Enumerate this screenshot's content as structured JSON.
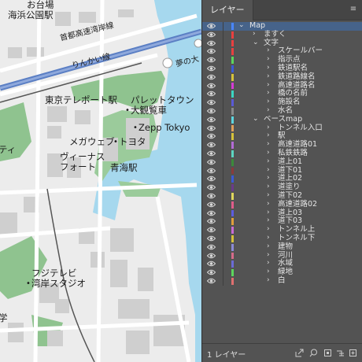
{
  "map": {
    "labels": [
      {
        "id": "odaiba",
        "text": "お台場"
      },
      {
        "id": "kaihin",
        "text": "海浜公園駅"
      },
      {
        "id": "shuto",
        "text": "首都高速湾岸線"
      },
      {
        "id": "rinkai",
        "text": "りんかい線"
      },
      {
        "id": "yume",
        "text": "夢の大"
      },
      {
        "id": "teleport",
        "text": "東京テレポート駅"
      },
      {
        "id": "palette",
        "text": "パレットタウン"
      },
      {
        "id": "kanransha",
        "text": "大観覧車"
      },
      {
        "id": "zepp",
        "text": "Zepp Tokyo"
      },
      {
        "id": "megaweb",
        "text": "メガウェブ"
      },
      {
        "id": "toyota",
        "text": "トヨタ"
      },
      {
        "id": "venus1",
        "text": "ヴィーナス"
      },
      {
        "id": "venus2",
        "text": "フォート"
      },
      {
        "id": "aomi",
        "text": "青海駅"
      },
      {
        "id": "fuji1",
        "text": "フジテレビ"
      },
      {
        "id": "fuji2",
        "text": "湾岸スタジオ"
      },
      {
        "id": "edge1",
        "text": "ティ"
      },
      {
        "id": "edge2",
        "text": "学"
      }
    ]
  },
  "panel": {
    "tab_label": "レイヤー",
    "menu_icon": "panel-menu-icon",
    "footer": {
      "count_label": "1 レイヤー",
      "icons": [
        "export-icon",
        "search-icon",
        "sublayer-icon",
        "collect-icon",
        "new-layer-icon",
        "trash-icon"
      ]
    },
    "layers": [
      {
        "name": "Map",
        "level": 0,
        "expanded": true,
        "color": "#4a86ff",
        "selected": true
      },
      {
        "name": "ますく",
        "level": 1,
        "expanded": false,
        "color": "#e94040"
      },
      {
        "name": "文字",
        "level": 1,
        "expanded": true,
        "color": "#e94040"
      },
      {
        "name": "スケールバー",
        "level": 2,
        "expanded": false,
        "color": "#e94040"
      },
      {
        "name": "指示点",
        "level": 2,
        "expanded": false,
        "color": "#5cd65c"
      },
      {
        "name": "鉄道駅名",
        "level": 2,
        "expanded": false,
        "color": "#3b5bd6"
      },
      {
        "name": "鉄道路線名",
        "level": 2,
        "expanded": false,
        "color": "#d6c23b"
      },
      {
        "name": "高速道路名",
        "level": 2,
        "expanded": false,
        "color": "#d63bd6"
      },
      {
        "name": "橋の名前",
        "level": 2,
        "expanded": false,
        "color": "#3bd6c2"
      },
      {
        "name": "施設名",
        "level": 2,
        "expanded": false,
        "color": "#5a5ad6"
      },
      {
        "name": "水名",
        "level": 2,
        "expanded": false,
        "color": "#8a8a8a"
      },
      {
        "name": "ベースmap",
        "level": 1,
        "expanded": true,
        "color": "#5cd6e0"
      },
      {
        "name": "トンネル入口",
        "level": 2,
        "expanded": false,
        "color": "#e0a05c"
      },
      {
        "name": "駅",
        "level": 2,
        "expanded": false,
        "color": "#d6c23b"
      },
      {
        "name": "高速道路01",
        "level": 2,
        "expanded": false,
        "color": "#b36bd6"
      },
      {
        "name": "私鉄鉄路",
        "level": 2,
        "expanded": false,
        "color": "#5cd6c2"
      },
      {
        "name": "道上01",
        "level": 2,
        "expanded": false,
        "color": "#3b8a3b"
      },
      {
        "name": "道下01",
        "level": 2,
        "expanded": false,
        "color": "#8a3b3b"
      },
      {
        "name": "道上02",
        "level": 2,
        "expanded": false,
        "color": "#3b5bd6"
      },
      {
        "name": "道塗り",
        "level": 2,
        "expanded": false,
        "color": "#6a3b8a"
      },
      {
        "name": "道下02",
        "level": 2,
        "expanded": false,
        "color": "#e0d65c"
      },
      {
        "name": "高速道路02",
        "level": 2,
        "expanded": false,
        "color": "#e05c8a"
      },
      {
        "name": "道上03",
        "level": 2,
        "expanded": false,
        "color": "#5c5ce0"
      },
      {
        "name": "道下03",
        "level": 2,
        "expanded": false,
        "color": "#e0a03b"
      },
      {
        "name": "トンネル上",
        "level": 2,
        "expanded": false,
        "color": "#c86bd6"
      },
      {
        "name": "トンネル下",
        "level": 2,
        "expanded": false,
        "color": "#d6c23b"
      },
      {
        "name": "建物",
        "level": 2,
        "expanded": false,
        "color": "#8a8ad6"
      },
      {
        "name": "河川",
        "level": 2,
        "expanded": false,
        "color": "#d66b8a"
      },
      {
        "name": "水域",
        "level": 2,
        "expanded": false,
        "color": "#6b6bd6"
      },
      {
        "name": "緑地",
        "level": 2,
        "expanded": false,
        "color": "#5cd65c"
      },
      {
        "name": "白",
        "level": 2,
        "expanded": false,
        "color": "#e07070"
      }
    ]
  }
}
